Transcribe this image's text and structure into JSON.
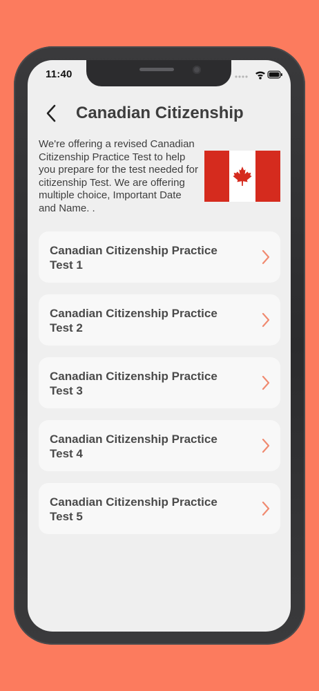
{
  "status_bar": {
    "time": "11:40"
  },
  "header": {
    "title": "Canadian Citizenship"
  },
  "intro_text": "We're offering a revised Canadian Citizenship Practice Test to help you prepare for the test needed for citizenship Test. We are offering multiple choice, Important Date and Name. .",
  "tests": [
    {
      "line1": "Canadian Citizenship Practice",
      "line2": "Test 1"
    },
    {
      "line1": "Canadian Citizenship Practice",
      "line2": "Test 2"
    },
    {
      "line1": "Canadian Citizenship Practice",
      "line2": "Test 3"
    },
    {
      "line1": "Canadian Citizenship Practice",
      "line2": "Test 4"
    },
    {
      "line1": "Canadian Citizenship Practice",
      "line2": "Test 5"
    }
  ],
  "colors": {
    "background": "#FC7B5E",
    "screen": "#EFEFEF",
    "card": "#F8F8F8",
    "chevron": "#F08A70",
    "flag_red": "#D52B1E"
  },
  "icons": {
    "back": "chevron-left-icon",
    "row": "chevron-right-icon",
    "flag": "canada-flag-icon"
  }
}
